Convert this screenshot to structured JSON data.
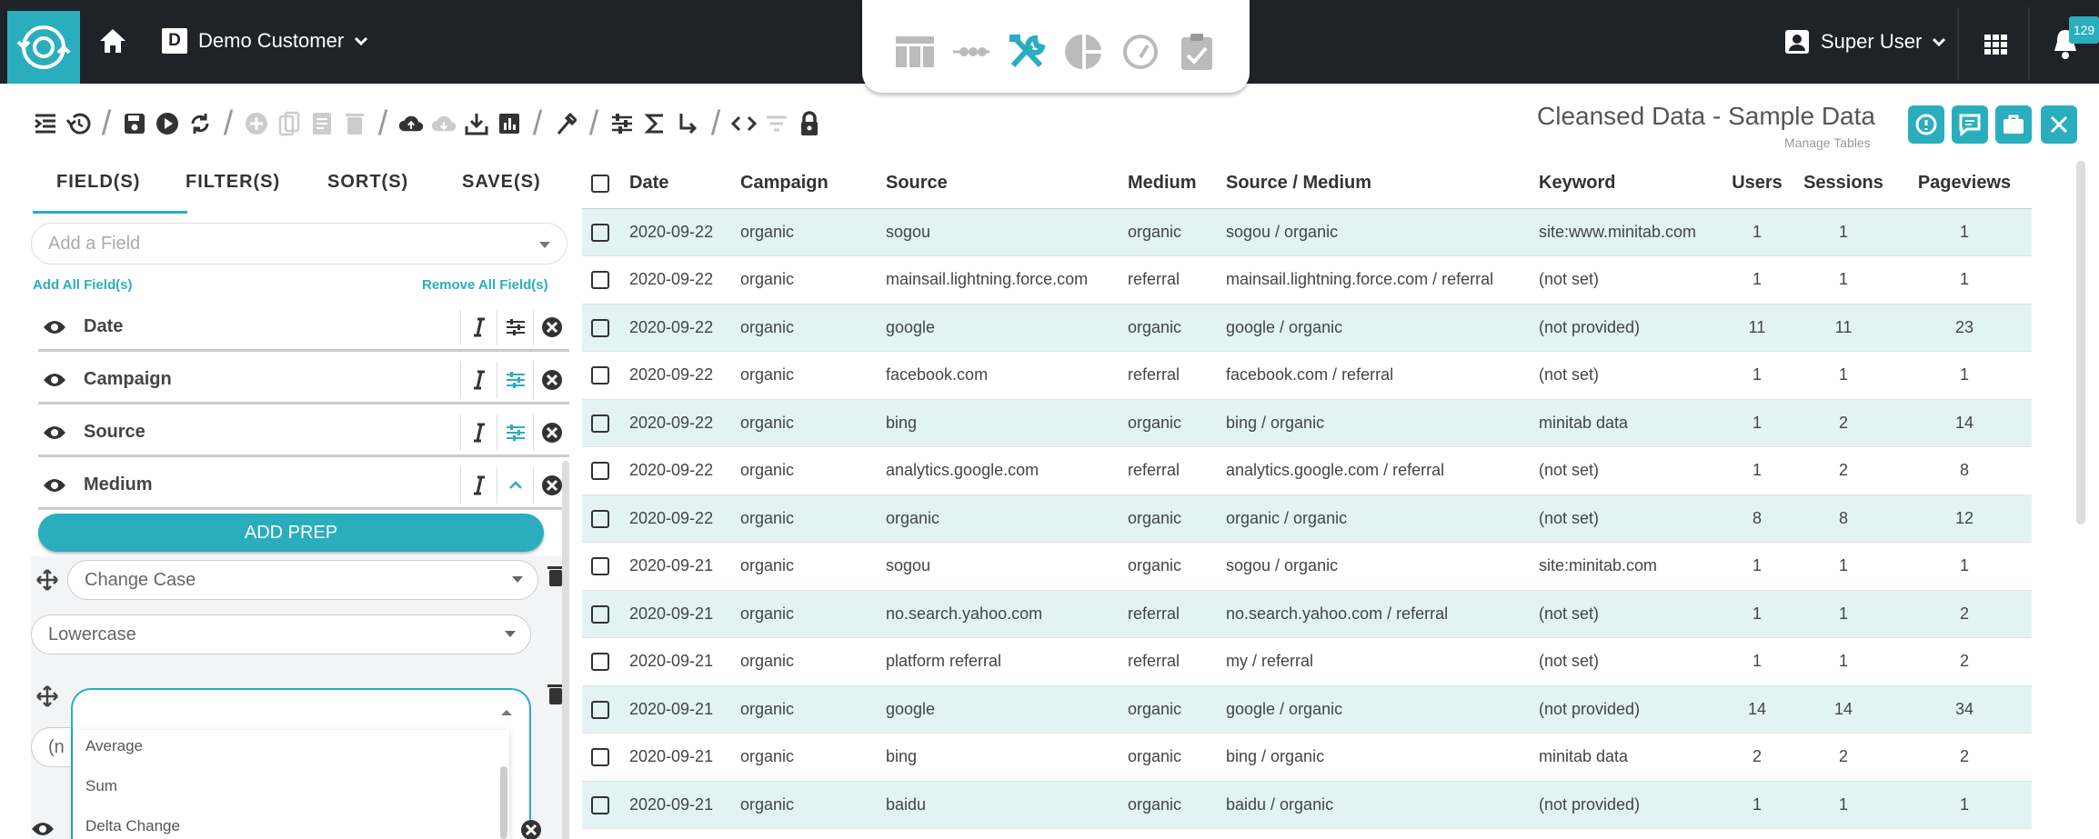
{
  "topbar": {
    "customer_initial": "D",
    "customer_name": "Demo Customer",
    "user_name": "Super User",
    "notification_count": "129",
    "center_icons": [
      "table-icon",
      "pipeline-icon",
      "tools-icon",
      "pie-chart-icon",
      "gauge-icon",
      "clipboard-check-icon"
    ]
  },
  "page": {
    "title": "Cleansed Data - Sample Data",
    "subtitle": "Manage Tables"
  },
  "left_panel": {
    "tabs": [
      "FIELD(S)",
      "FILTER(S)",
      "SORT(S)",
      "SAVE(S)"
    ],
    "add_field_placeholder": "Add a Field",
    "add_all": "Add All Field(s)",
    "remove_all": "Remove All Field(s)",
    "fields": [
      "Date",
      "Campaign",
      "Source",
      "Medium"
    ],
    "add_prep": "ADD PREP",
    "prep_step1": "Change Case",
    "prep_step1_option": "Lowercase",
    "prep_step2_partial": "(n",
    "dropdown_options": [
      "Average",
      "Sum",
      "Delta Change"
    ]
  },
  "table": {
    "columns": [
      "Date",
      "Campaign",
      "Source",
      "Medium",
      "Source / Medium",
      "Keyword",
      "Users",
      "Sessions",
      "Pageviews"
    ],
    "rows": [
      [
        "2020-09-22",
        "organic",
        "sogou",
        "organic",
        "sogou / organic",
        "site:www.minitab.com",
        "1",
        "1",
        "1"
      ],
      [
        "2020-09-22",
        "organic",
        "mainsail.lightning.force.com",
        "referral",
        "mainsail.lightning.force.com / referral",
        "(not set)",
        "1",
        "1",
        "1"
      ],
      [
        "2020-09-22",
        "organic",
        "google",
        "organic",
        "google / organic",
        "(not provided)",
        "11",
        "11",
        "23"
      ],
      [
        "2020-09-22",
        "organic",
        "facebook.com",
        "referral",
        "facebook.com / referral",
        "(not set)",
        "1",
        "1",
        "1"
      ],
      [
        "2020-09-22",
        "organic",
        "bing",
        "organic",
        "bing / organic",
        "minitab data",
        "1",
        "2",
        "14"
      ],
      [
        "2020-09-22",
        "organic",
        "analytics.google.com",
        "referral",
        "analytics.google.com / referral",
        "(not set)",
        "1",
        "2",
        "8"
      ],
      [
        "2020-09-22",
        "organic",
        "organic",
        "organic",
        "organic / organic",
        "(not set)",
        "8",
        "8",
        "12"
      ],
      [
        "2020-09-21",
        "organic",
        "sogou",
        "organic",
        "sogou / organic",
        "site:minitab.com",
        "1",
        "1",
        "1"
      ],
      [
        "2020-09-21",
        "organic",
        "no.search.yahoo.com",
        "referral",
        "no.search.yahoo.com / referral",
        "(not set)",
        "1",
        "1",
        "2"
      ],
      [
        "2020-09-21",
        "organic",
        "platform referral",
        "referral",
        "my / referral",
        "(not set)",
        "1",
        "1",
        "2"
      ],
      [
        "2020-09-21",
        "organic",
        "google",
        "organic",
        "google / organic",
        "(not provided)",
        "14",
        "14",
        "34"
      ],
      [
        "2020-09-21",
        "organic",
        "bing",
        "organic",
        "bing / organic",
        "minitab data",
        "2",
        "2",
        "2"
      ],
      [
        "2020-09-21",
        "organic",
        "baidu",
        "organic",
        "baidu / organic",
        "(not provided)",
        "1",
        "1",
        "1"
      ]
    ]
  },
  "colors": {
    "accent": "#2aaebe",
    "topbar": "#1f2226",
    "row_alt": "#e3f3f4"
  }
}
